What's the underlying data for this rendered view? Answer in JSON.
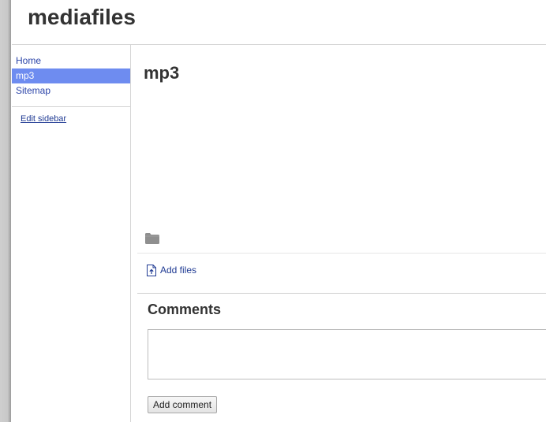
{
  "site": {
    "title": "mediafiles"
  },
  "sidebar": {
    "items": [
      {
        "label": "Home",
        "active": false
      },
      {
        "label": "mp3",
        "active": true
      },
      {
        "label": "Sitemap",
        "active": false
      }
    ],
    "edit_label": "Edit sidebar",
    "active_color": "#6e8cf0",
    "link_color": "#2a43a8"
  },
  "main": {
    "page_title": "mp3",
    "folder_icon": "folder-icon",
    "add_files_label": "Add files",
    "add_files_icon": "file-upload-icon"
  },
  "comments": {
    "heading": "Comments",
    "textarea_value": "",
    "add_button_label": "Add comment"
  }
}
